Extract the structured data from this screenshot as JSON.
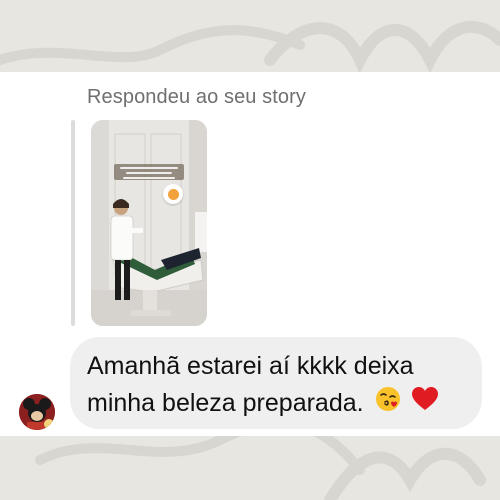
{
  "header": {
    "reply_label": "Respondeu ao seu story"
  },
  "story": {
    "caption_lines": 3,
    "sticker_icon": "emoji-sticker"
  },
  "message": {
    "line1": "Amanhã estarei aí kkkk deixa",
    "line2": "minha beleza preparada.",
    "emojis": [
      "kissing-face-heart-emoji",
      "red-heart-emoji"
    ]
  },
  "colors": {
    "background": "#e7e6e1",
    "card": "#ffffff",
    "bubble": "#efefef",
    "label": "#6f6f6f",
    "text": "#111111",
    "heart": "#e11b22"
  }
}
